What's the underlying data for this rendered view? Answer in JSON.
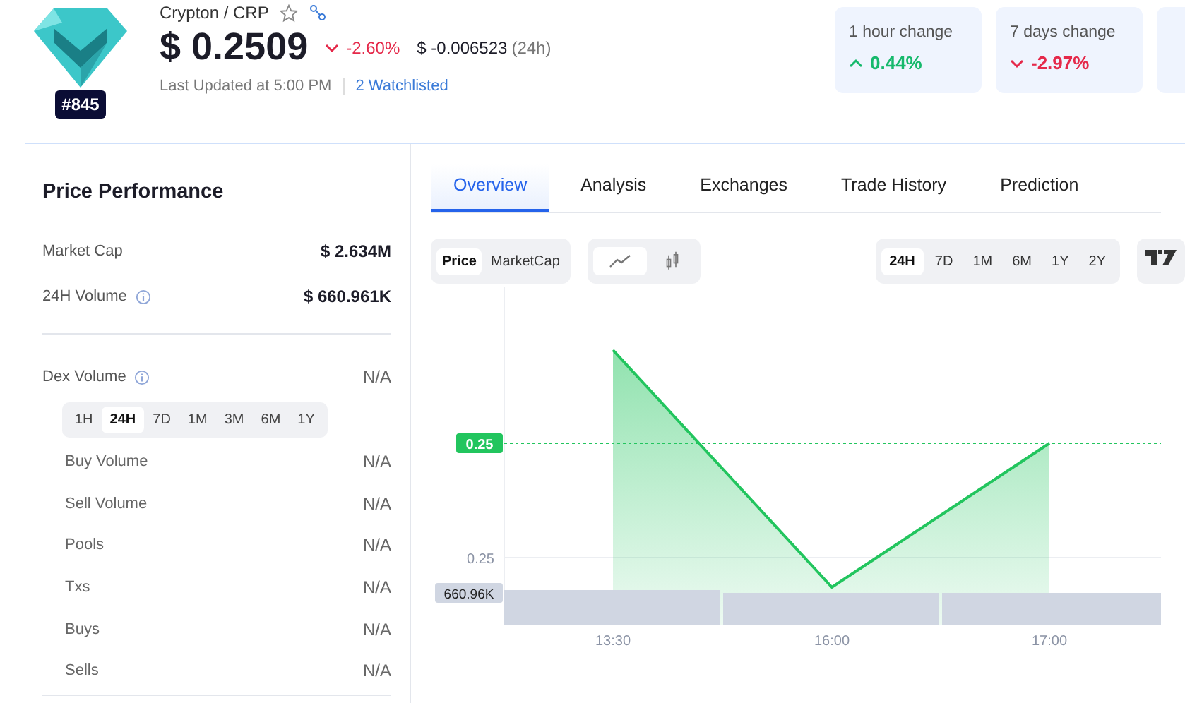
{
  "coin": {
    "name": "Crypton / CRP",
    "rank": "#845",
    "price": "$ 0.2509",
    "kind": "down",
    "change_pct": "-2.60%",
    "change_abs": "$ -0.006523",
    "change_period": "(24h)",
    "updated": "Last Updated at 5:00 PM",
    "watchlisted": "2 Watchlisted"
  },
  "change_cards": [
    {
      "label": "1 hour change",
      "value": "0.44%",
      "kind": "up"
    },
    {
      "label": "7 days change",
      "value": "-2.97%",
      "kind": "down"
    }
  ],
  "performance": {
    "title": "Price Performance",
    "stats": [
      {
        "label": "Market Cap",
        "value": "$ 2.634M",
        "info": false
      },
      {
        "label": "24H Volume",
        "value": "$ 660.961K",
        "info": true
      }
    ],
    "dex": {
      "label": "Dex Volume",
      "value": "N/A",
      "info": true,
      "periods": [
        {
          "label": "1H",
          "selected": false
        },
        {
          "label": "24H",
          "selected": true
        },
        {
          "label": "7D",
          "selected": false
        },
        {
          "label": "1M",
          "selected": false
        },
        {
          "label": "3M",
          "selected": false
        },
        {
          "label": "6M",
          "selected": false
        },
        {
          "label": "1Y",
          "selected": false
        }
      ],
      "rows": [
        {
          "label": "Buy Volume",
          "value": "N/A"
        },
        {
          "label": "Sell Volume",
          "value": "N/A"
        },
        {
          "label": "Pools",
          "value": "N/A"
        },
        {
          "label": "Txs",
          "value": "N/A"
        },
        {
          "label": "Buys",
          "value": "N/A"
        },
        {
          "label": "Sells",
          "value": "N/A"
        }
      ]
    }
  },
  "tabs": [
    {
      "label": "Overview",
      "selected": true
    },
    {
      "label": "Analysis",
      "selected": false
    },
    {
      "label": "Exchanges",
      "selected": false
    },
    {
      "label": "Trade History",
      "selected": false
    },
    {
      "label": "Prediction",
      "selected": false
    }
  ],
  "chart_toolbar": {
    "metrics": [
      {
        "label": "Price",
        "selected": true
      },
      {
        "label": "MarketCap",
        "selected": false
      }
    ],
    "styles": [
      {
        "kind": "line",
        "selected": true
      },
      {
        "kind": "candles",
        "selected": false
      }
    ],
    "ranges": [
      {
        "label": "24H",
        "selected": true
      },
      {
        "label": "7D",
        "selected": false
      },
      {
        "label": "1M",
        "selected": false
      },
      {
        "label": "6M",
        "selected": false
      },
      {
        "label": "1Y",
        "selected": false
      },
      {
        "label": "2Y",
        "selected": false
      }
    ]
  },
  "chart": {
    "price_tag": "0.25",
    "y_label": "0.25",
    "volume_tag": "660.96K",
    "x_labels": [
      "13:30",
      "16:00",
      "17:00"
    ]
  }
}
